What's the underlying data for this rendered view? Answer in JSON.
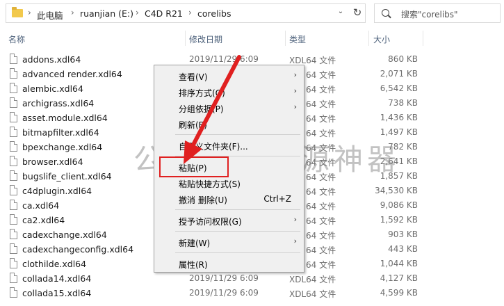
{
  "address_bar": {
    "crumbs": [
      "此电脑",
      "ruanjian (E:)",
      "C4D R21",
      "corelibs"
    ],
    "separator": "›"
  },
  "search": {
    "placeholder": "搜索\"corelibs\""
  },
  "columns": {
    "name": "名称",
    "modified": "修改日期",
    "type": "类型",
    "size": "大小"
  },
  "files": [
    {
      "name": "addons.xdl64",
      "date": "2019/11/29 6:09",
      "type": "XDL64 文件",
      "size": "860 KB"
    },
    {
      "name": "advanced render.xdl64",
      "date": "",
      "type": "64 文件",
      "size": "2,071 KB"
    },
    {
      "name": "alembic.xdl64",
      "date": "",
      "type": "64 文件",
      "size": "6,542 KB"
    },
    {
      "name": "archigrass.xdl64",
      "date": "",
      "type": "64 文件",
      "size": "738 KB"
    },
    {
      "name": "asset.module.xdl64",
      "date": "",
      "type": "64 文件",
      "size": "1,436 KB"
    },
    {
      "name": "bitmapfilter.xdl64",
      "date": "",
      "type": "64 文件",
      "size": "1,497 KB"
    },
    {
      "name": "bpexchange.xdl64",
      "date": "",
      "type": "64 文件",
      "size": "782 KB"
    },
    {
      "name": "browser.xdl64",
      "date": "",
      "type": "64 文件",
      "size": "2,641 KB"
    },
    {
      "name": "bugslife_client.xdl64",
      "date": "",
      "type": "64 文件",
      "size": "1,857 KB"
    },
    {
      "name": "c4dplugin.xdl64",
      "date": "",
      "type": "64 文件",
      "size": "34,530 KB"
    },
    {
      "name": "ca.xdl64",
      "date": "",
      "type": "64 文件",
      "size": "9,086 KB"
    },
    {
      "name": "ca2.xdl64",
      "date": "",
      "type": "64 文件",
      "size": "1,592 KB"
    },
    {
      "name": "cadexchange.xdl64",
      "date": "",
      "type": "64 文件",
      "size": "903 KB"
    },
    {
      "name": "cadexchangeconfig.xdl64",
      "date": "",
      "type": "64 文件",
      "size": "443 KB"
    },
    {
      "name": "clothilde.xdl64",
      "date": "",
      "type": "64 文件",
      "size": "1,044 KB"
    },
    {
      "name": "collada14.xdl64",
      "date": "2019/11/29 6:09",
      "type": "XDL64 文件",
      "size": "4,127 KB"
    },
    {
      "name": "collada15.xdl64",
      "date": "2019/11/29 6:09",
      "type": "XDL64 文件",
      "size": "4,599 KB"
    }
  ],
  "context_menu": {
    "items": [
      {
        "label": "查看(V)",
        "arrow": "›"
      },
      {
        "label": "排序方式(O)",
        "arrow": "›"
      },
      {
        "label": "分组依据(P)",
        "arrow": "›"
      },
      {
        "label": "刷新(E)"
      },
      {
        "label": "自定义文件夹(F)..."
      },
      {
        "label": "粘贴(P)"
      },
      {
        "label": "粘贴快捷方式(S)"
      },
      {
        "label": "撤消 删除(U)",
        "shortcut": "Ctrl+Z"
      },
      {
        "label": "授予访问权限(G)",
        "arrow": "›"
      },
      {
        "label": "新建(W)",
        "arrow": "›"
      },
      {
        "label": "属性(R)"
      }
    ]
  },
  "watermark": "公众号：开源神器",
  "colors": {
    "highlight": "#e02020",
    "header_text": "#4c607a",
    "menu_bg": "#f0f0f0"
  }
}
